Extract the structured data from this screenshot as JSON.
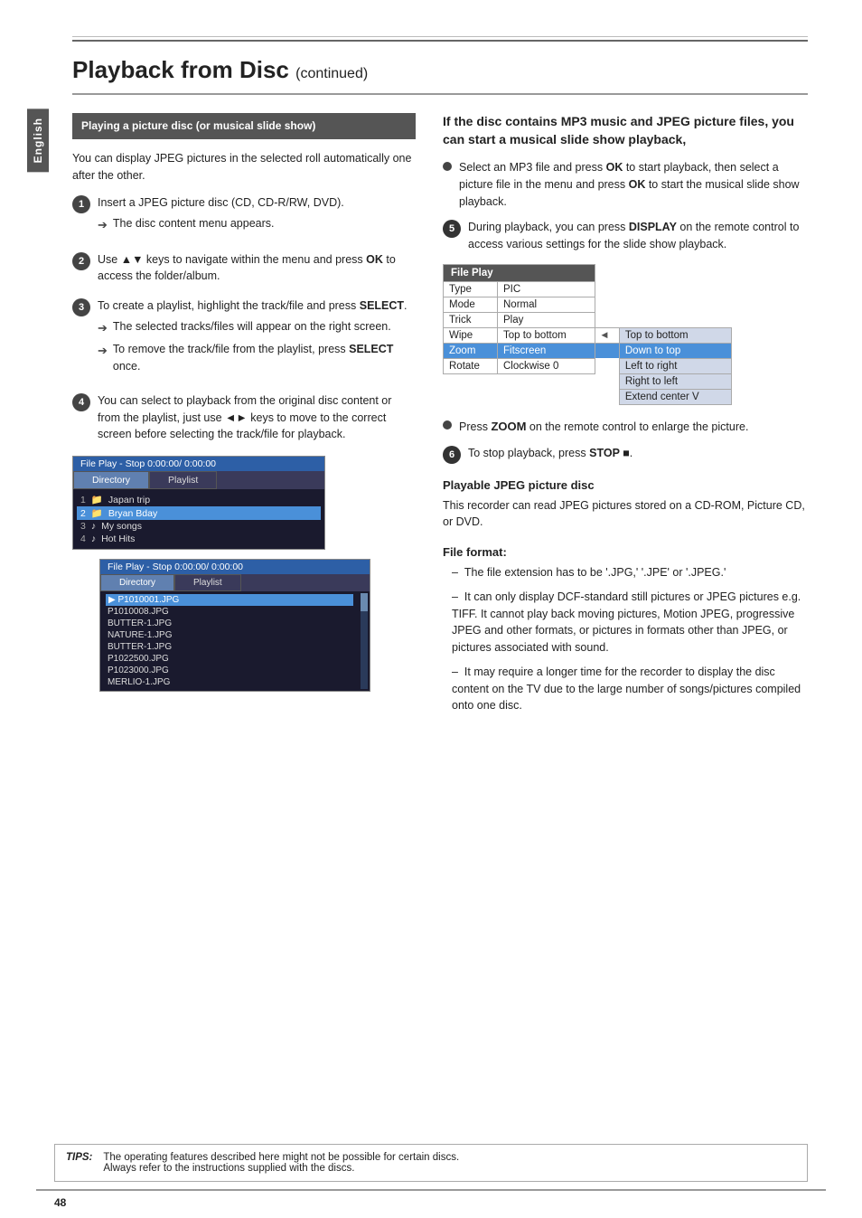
{
  "page": {
    "title": "Playback from Disc",
    "title_continued": "(continued)",
    "page_number": "48",
    "sidebar_label": "English"
  },
  "left_column": {
    "section_header": "Playing a picture disc (or musical slide show)",
    "intro_text": "You can display JPEG pictures in the selected roll automatically one after the other.",
    "steps": [
      {
        "number": "1",
        "text": "Insert a JPEG picture disc (CD, CD-R/RW, DVD).",
        "arrow_items": [
          "The disc content menu appears."
        ]
      },
      {
        "number": "2",
        "text": "Use ▲▼ keys to navigate within the menu and press OK to access the folder/album."
      },
      {
        "number": "3",
        "text": "To create a playlist, highlight the track/file and press SELECT.",
        "arrow_items": [
          "The selected tracks/files will appear on the right screen.",
          "To remove the track/file from the playlist, press SELECT once."
        ]
      },
      {
        "number": "4",
        "text": "You can select to playback from the original disc content or from the playlist, just use ◄► keys to move to the correct screen before selecting the track/file for playback."
      }
    ],
    "screenshot_title": "File Play - Stop 0:00:00/ 0:00:00",
    "screenshot_tabs": [
      "Directory",
      "Playlist"
    ],
    "screenshot_items": [
      {
        "number": "1",
        "icon": "folder",
        "label": "Japan trip"
      },
      {
        "number": "2",
        "icon": "folder",
        "label": "Bryan Bday"
      },
      {
        "number": "3",
        "icon": "music",
        "label": "My songs"
      },
      {
        "number": "4",
        "icon": "music",
        "label": "Hot Hits"
      }
    ],
    "nested_screenshot_title": "File Play - Stop 0:00:00/ 0:00:00",
    "nested_tabs": [
      "Directory",
      "Playlist"
    ],
    "nested_items": [
      "P1010001.JPG",
      "P1010008.JPG",
      "BUTTER-1.JPG",
      "NATURE-1.JPG",
      "BUTTER-1.JPG",
      "P1022500.JPG",
      "P1023000.JPG",
      "MERLIO-1.JPG"
    ]
  },
  "right_column": {
    "heading": "If the disc contains MP3 music and JPEG picture files, you can start a musical slide show playback,",
    "bullet_items": [
      "Select an MP3 file and press OK to start playback, then select a picture file in the menu and press OK to start the musical slide show playback.",
      "During playback, you can press DISPLAY on the remote control to access various settings for the slide show playback."
    ],
    "file_play_table": {
      "header": "File Play",
      "rows": [
        {
          "label": "Type",
          "value": "PIC",
          "options": []
        },
        {
          "label": "Mode",
          "value": "Normal",
          "options": []
        },
        {
          "label": "Trick",
          "value": "Play",
          "options": []
        },
        {
          "label": "Wipe",
          "value": "Top to bottom",
          "highlighted": false,
          "options": [
            "Top to bottom",
            "Down to top",
            "Left to right",
            "Right to left",
            "Extend center V"
          ]
        },
        {
          "label": "Zoom",
          "value": "Fitscreen",
          "highlighted": true,
          "options": []
        },
        {
          "label": "Rotate",
          "value": "Clockwise 0",
          "options": []
        }
      ]
    },
    "zoom_text": "Press ZOOM on the remote control to enlarge the picture.",
    "step6_text": "To stop playback, press STOP ■.",
    "playable_title": "Playable JPEG picture disc",
    "playable_text": "This recorder can read JPEG pictures stored on a CD-ROM, Picture CD, or DVD.",
    "file_format_title": "File format:",
    "file_format_items": [
      "The file extension has to be '.JPG,' '.JPE' or '.JPEG.'",
      "It can only display DCF-standard still pictures or JPEG pictures e.g. TIFF. It cannot play back moving pictures, Motion JPEG, progressive JPEG and other formats, or pictures in formats other than JPEG, or pictures associated with sound.",
      "It may require a longer time for the recorder to display the disc content on the TV due to the large number of songs/pictures compiled onto one disc."
    ]
  },
  "tips": {
    "label": "TIPS:",
    "text": "The operating features described here might not be possible for certain discs.\nAlways refer to the instructions supplied with the discs."
  }
}
